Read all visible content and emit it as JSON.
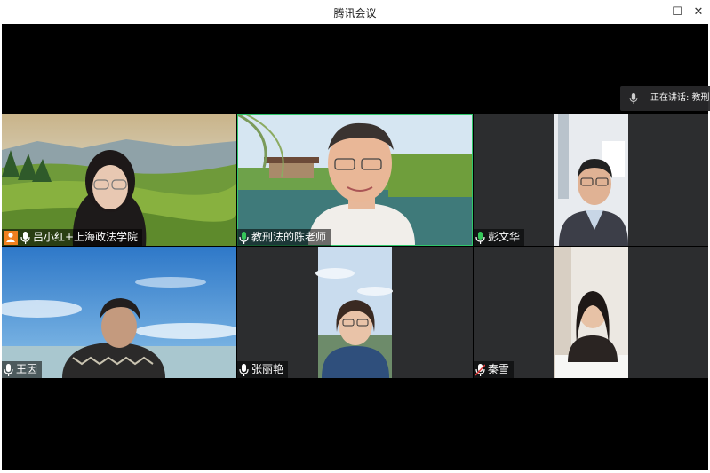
{
  "window": {
    "title": "腾讯会议"
  },
  "controls": {
    "minimize": "—",
    "maximize": "☐",
    "close": "✕"
  },
  "speaking": {
    "label": "正在讲话: 教刑"
  },
  "participants": [
    {
      "name": "吕小红+上海政法学院",
      "mic": "on"
    },
    {
      "name": "教刑法的陈老师",
      "mic": "on"
    },
    {
      "name": "彭文华",
      "mic": "on"
    },
    {
      "name": "王因",
      "mic": "on"
    },
    {
      "name": "张丽艳",
      "mic": "on"
    },
    {
      "name": "秦雪",
      "mic": "muted"
    }
  ],
  "colors": {
    "active_border": "#2fc76b",
    "mic_on": "#35c75a",
    "mic_muted": "#e03b3b",
    "avatar_badge": "#f0801e"
  }
}
